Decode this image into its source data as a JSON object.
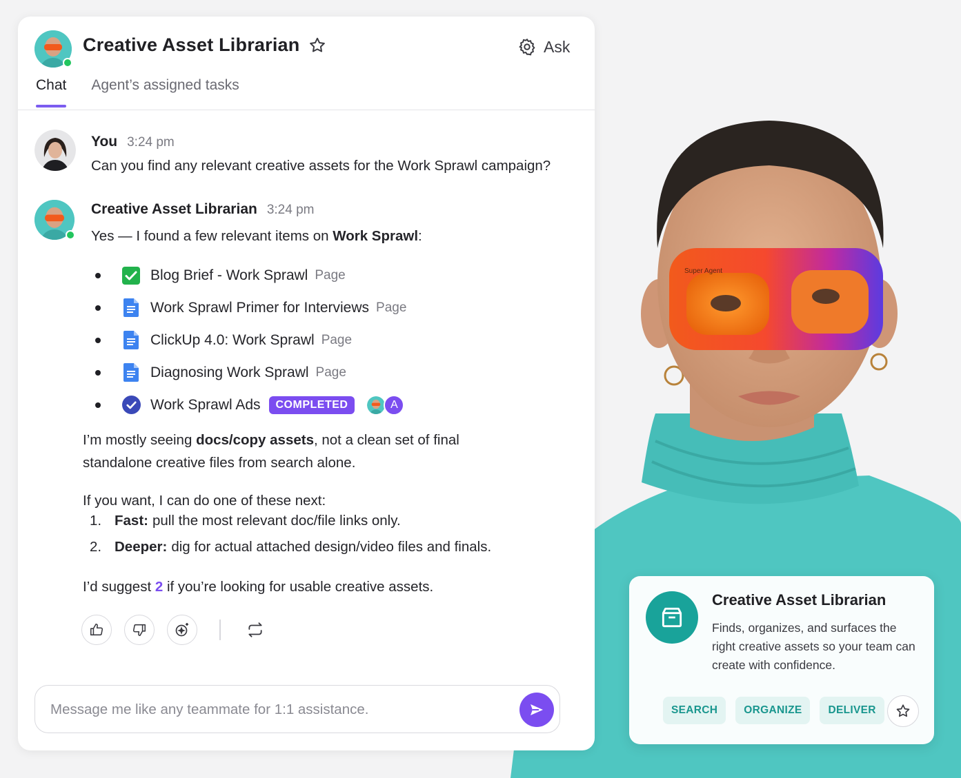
{
  "header": {
    "agent_name": "Creative Asset Librarian",
    "ask_label": "Ask",
    "tabs": [
      {
        "label": "Chat",
        "active": true
      },
      {
        "label": "Agent’s assigned tasks",
        "active": false
      }
    ]
  },
  "messages": [
    {
      "sender": "You",
      "time": "3:24 pm",
      "text": "Can you find any relevant creative assets for the Work Sprawl campaign?"
    },
    {
      "sender": "Creative Asset Librarian",
      "time": "3:24 pm",
      "intro_prefix": "Yes — I found a few relevant items on ",
      "intro_bold": "Work Sprawl",
      "intro_suffix": ":",
      "assets": [
        {
          "name": "Blog Brief - Work Sprawl",
          "type": "Page",
          "icon": "green-check-icon"
        },
        {
          "name": "Work Sprawl Primer for Interviews",
          "type": "Page",
          "icon": "document-icon"
        },
        {
          "name": "ClickUp 4.0: Work Sprawl",
          "type": "Page",
          "icon": "document-icon"
        },
        {
          "name": "Diagnosing Work Sprawl",
          "type": "Page",
          "icon": "document-icon"
        },
        {
          "name": "Work Sprawl Ads",
          "type": "",
          "icon": "task-complete-icon",
          "status": "COMPLETED",
          "assignee_letter": "A"
        }
      ],
      "para1_prefix": "I’m mostly seeing ",
      "para1_bold": "docs/copy assets",
      "para1_line1_suffix": ", not a clean set of final",
      "para1_line2": "standalone creative files from search alone.",
      "para2": "If you want, I can do one of these next:",
      "options": [
        {
          "num": "1.",
          "bold": "Fast:",
          "text": "pull the most relevant doc/file links only."
        },
        {
          "num": "2.",
          "bold": "Deeper:",
          "text": "dig for actual attached design/video files and finals."
        }
      ],
      "suggest_prefix": "I’d suggest ",
      "suggest_num": "2",
      "suggest_suffix": " if you’re looking for usable creative assets."
    }
  ],
  "composer": {
    "placeholder": "Message me like any teammate for 1:1 assistance."
  },
  "agent_card": {
    "title": "Creative Asset Librarian",
    "description": "Finds, organizes, and surfaces the right creative assets so your team can create with confidence.",
    "tags": [
      "SEARCH",
      "ORGANIZE",
      "DELIVER"
    ]
  },
  "portrait": {
    "goggles_text": "Super Agent"
  },
  "colors": {
    "accent": "#7b4df0",
    "teal": "#19a39a",
    "online": "#22c55e",
    "shirt": "#4fc6c1"
  }
}
